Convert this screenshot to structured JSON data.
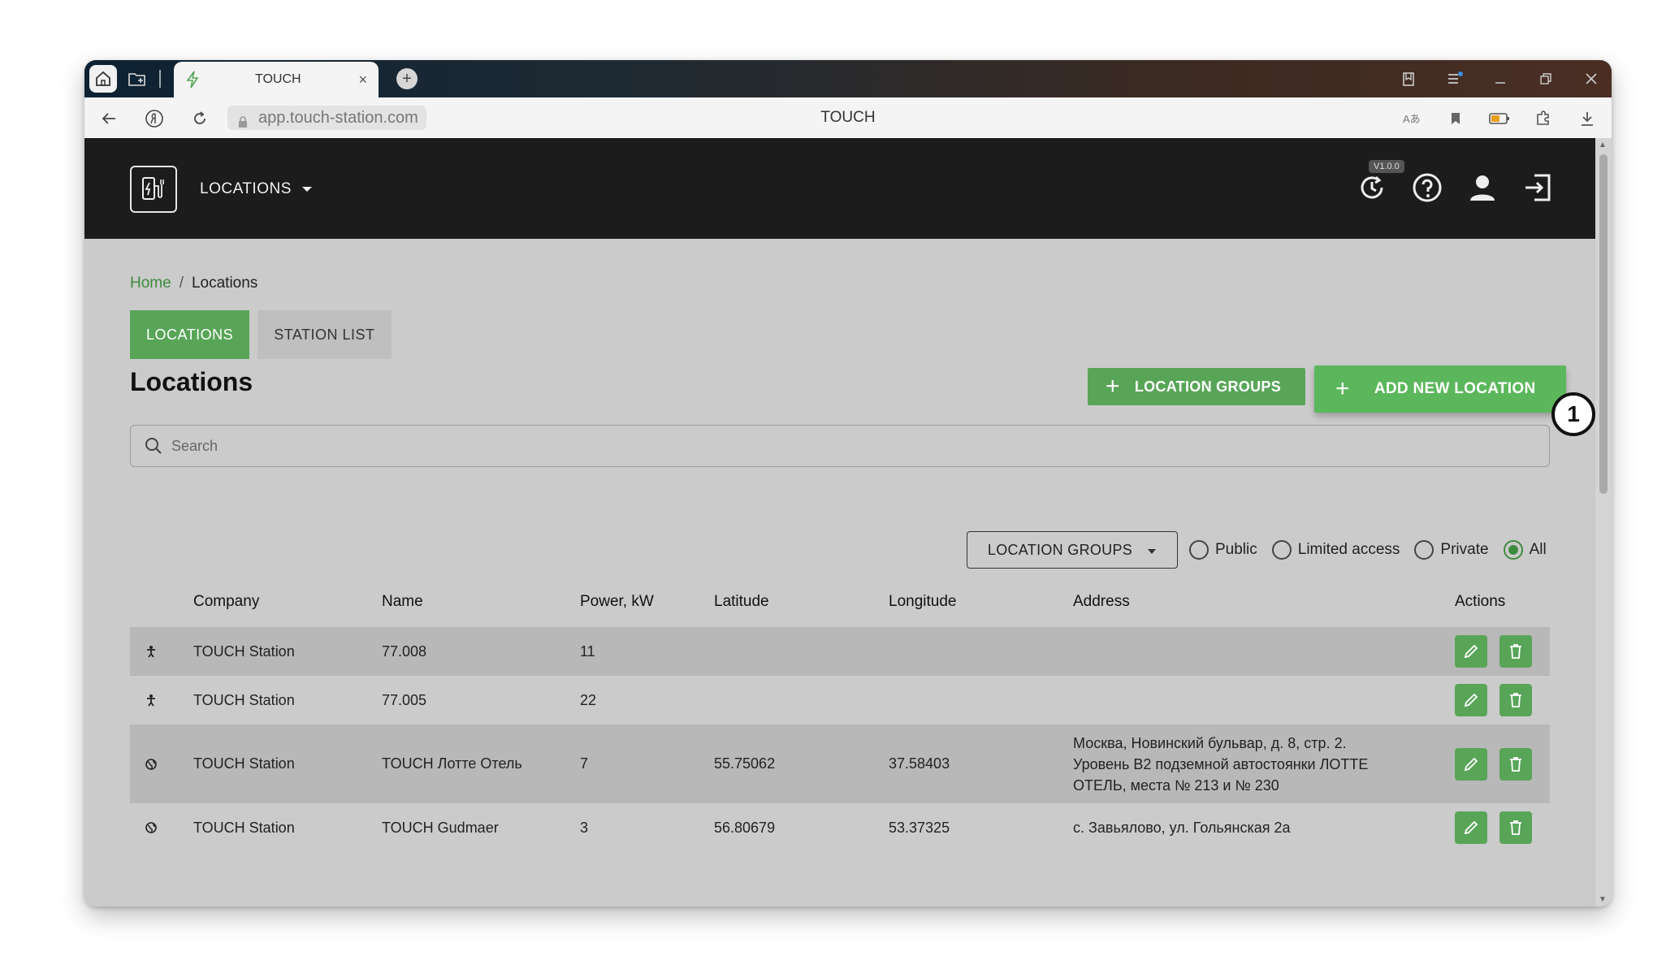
{
  "browser": {
    "tab_title": "TOUCH",
    "tab_close": "×",
    "new_tab": "+",
    "url": "app.touch-station.com",
    "page_title": "TOUCH"
  },
  "header": {
    "menu_label": "LOCATIONS",
    "version": "V1.0.0"
  },
  "breadcrumb": {
    "home": "Home",
    "separator": "/",
    "current": "Locations"
  },
  "tabs": [
    {
      "label": "LOCATIONS"
    },
    {
      "label": "STATION LIST"
    }
  ],
  "page_title": "Locations",
  "buttons": {
    "location_groups": "LOCATION GROUPS",
    "add_new_location": "ADD NEW LOCATION",
    "plus": "+"
  },
  "callout": "1",
  "search": {
    "placeholder": "Search",
    "value": ""
  },
  "filter": {
    "dropdown_label": "LOCATION GROUPS",
    "radios": [
      {
        "label": "Public",
        "selected": false
      },
      {
        "label": "Limited access",
        "selected": false
      },
      {
        "label": "Private",
        "selected": false
      },
      {
        "label": "All",
        "selected": true
      }
    ]
  },
  "table": {
    "headers": [
      "Company",
      "Name",
      "Power, kW",
      "Latitude",
      "Longitude",
      "Address",
      "Actions"
    ],
    "rows": [
      {
        "icon": "person-icon",
        "company": "TOUCH Station",
        "name": "77.008",
        "power": "11",
        "lat": "",
        "lon": "",
        "address": ""
      },
      {
        "icon": "person-icon",
        "company": "TOUCH Station",
        "name": "77.005",
        "power": "22",
        "lat": "",
        "lon": "",
        "address": ""
      },
      {
        "icon": "globe-icon",
        "company": "TOUCH Station",
        "name": "TOUCH Лотте Отель",
        "power": "7",
        "lat": "55.75062",
        "lon": "37.58403",
        "address": "Москва, Новинский бульвар, д. 8, стр. 2. Уровень B2 подземной автостоянки ЛОТТЕ ОТЕЛЬ, места № 213 и № 230"
      },
      {
        "icon": "globe-icon",
        "company": "TOUCH Station",
        "name": "TOUCH Gudmaer",
        "power": "3",
        "lat": "56.80679",
        "lon": "53.37325",
        "address": "с. Завьялово, ул. Гольянская 2а"
      }
    ]
  },
  "colors": {
    "accent": "#58a558",
    "header_bg": "#1c1c1c",
    "content_bg": "#cbcbcb"
  }
}
